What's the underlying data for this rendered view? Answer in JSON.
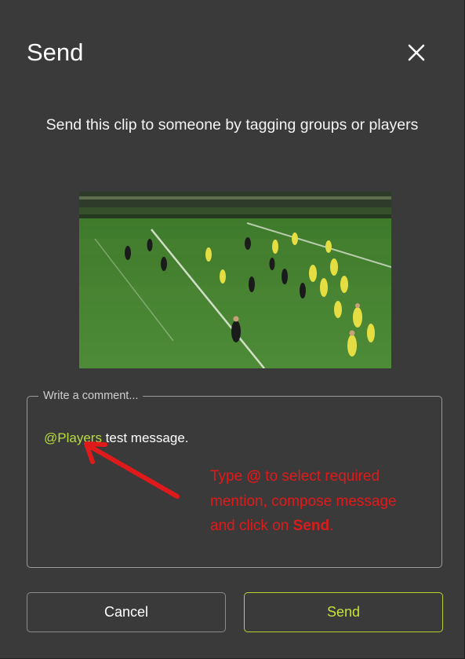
{
  "dialog": {
    "title": "Send",
    "close_icon": "close-icon",
    "subtitle": "Send this clip to someone by tagging groups or players"
  },
  "clip": {
    "thumbnail": "rugby-match-video-thumbnail"
  },
  "comment": {
    "label": "Write a comment...",
    "mention": "@Players",
    "message": " test message."
  },
  "annotation": {
    "line1_prefix": "Type ",
    "line1_at": "@",
    "line1_suffix": " to select required",
    "line2": "mention, compose message",
    "line3_prefix": "and click on ",
    "line3_bold": "Send",
    "line3_suffix": ".",
    "color": "#e01a1a"
  },
  "buttons": {
    "cancel_label": "Cancel",
    "send_label": "Send"
  },
  "colors": {
    "background": "#3a3a3a",
    "accent": "#b9dc3c",
    "annotation": "#e01a1a"
  }
}
